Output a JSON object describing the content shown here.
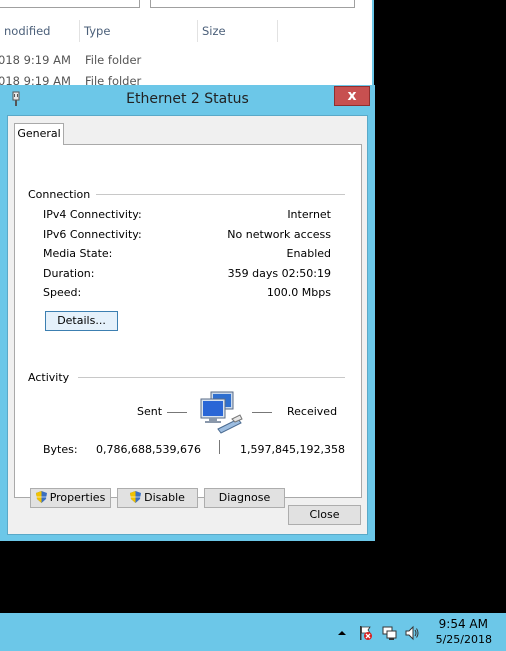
{
  "explorer": {
    "columns": [
      {
        "label": "nodified",
        "width": 80
      },
      {
        "label": "Type",
        "width": 118
      },
      {
        "label": "Size",
        "width": 80
      }
    ],
    "rows": [
      {
        "modified": "018 9:19 AM",
        "type": "File folder"
      },
      {
        "modified": "018 9:19 AM",
        "type": "File folder"
      }
    ]
  },
  "dialog": {
    "title": "Ethernet 2 Status",
    "close_label": "x",
    "tab_label": "General",
    "connection": {
      "group_label": "Connection",
      "rows": [
        {
          "label": "IPv4 Connectivity:",
          "value": "Internet"
        },
        {
          "label": "IPv6 Connectivity:",
          "value": "No network access"
        },
        {
          "label": "Media State:",
          "value": "Enabled"
        },
        {
          "label": "Duration:",
          "value": "359 days 02:50:19"
        },
        {
          "label": "Speed:",
          "value": "100.0 Mbps"
        }
      ],
      "details_label": "Details..."
    },
    "activity": {
      "group_label": "Activity",
      "sent_label": "Sent",
      "received_label": "Received",
      "bytes_label": "Bytes:",
      "bytes_sent": "0,786,688,539,676",
      "bytes_received": "1,597,845,192,358"
    },
    "buttons": {
      "properties": "Properties",
      "disable": "Disable",
      "diagnose": "Diagnose",
      "close": "Close"
    }
  },
  "taskbar": {
    "time": "9:54 AM",
    "date": "5/25/2018",
    "tray_icons": [
      "chevron-up-icon",
      "action-center-flag-icon",
      "network-icon",
      "volume-icon"
    ]
  },
  "colors": {
    "accent": "#6cc7e8",
    "close_red": "#c75050"
  }
}
